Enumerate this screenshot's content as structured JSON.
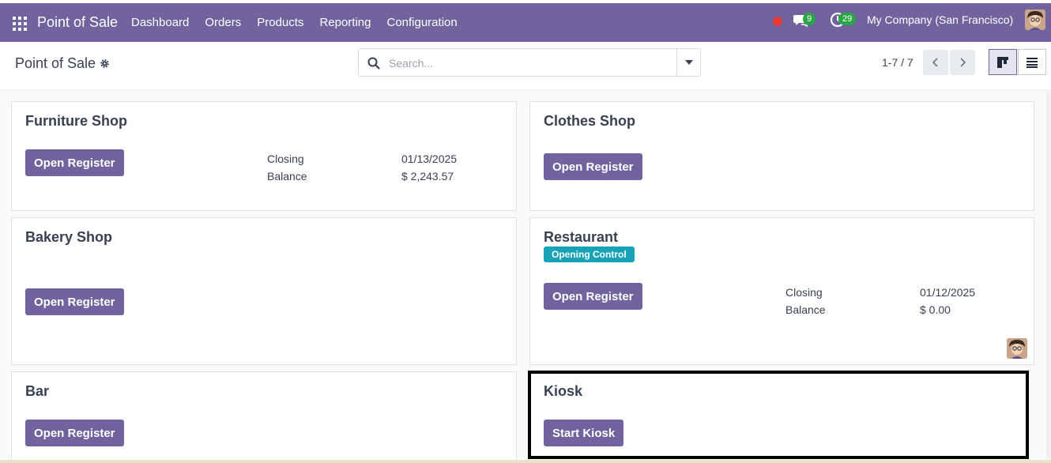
{
  "navbar": {
    "brand": "Point of Sale",
    "menu": [
      "Dashboard",
      "Orders",
      "Products",
      "Reporting",
      "Configuration"
    ],
    "messages_count": "9",
    "activities_count": "29",
    "company": "My Company (San Francisco)",
    "color": "#71639e"
  },
  "control_panel": {
    "title": "Point of Sale",
    "search_placeholder": "Search...",
    "pager": "1-7 / 7"
  },
  "cards": {
    "furniture": {
      "name": "Furniture Shop",
      "button": "Open Register",
      "closing_label": "Closing",
      "closing_value": "01/13/2025",
      "balance_label": "Balance",
      "balance_value": "$ 2,243.57"
    },
    "clothes": {
      "name": "Clothes Shop",
      "button": "Open Register"
    },
    "bakery": {
      "name": "Bakery Shop",
      "button": "Open Register"
    },
    "restaurant": {
      "name": "Restaurant",
      "badge": "Opening Control",
      "button": "Open Register",
      "closing_label": "Closing",
      "closing_value": "01/12/2025",
      "balance_label": "Balance",
      "balance_value": "$ 0.00"
    },
    "bar": {
      "name": "Bar",
      "button": "Open Register"
    },
    "kiosk": {
      "name": "Kiosk",
      "button": "Start Kiosk"
    }
  },
  "colors": {
    "primary": "#71639e",
    "badge": "#17a2b8",
    "badge_green": "#28a745"
  }
}
